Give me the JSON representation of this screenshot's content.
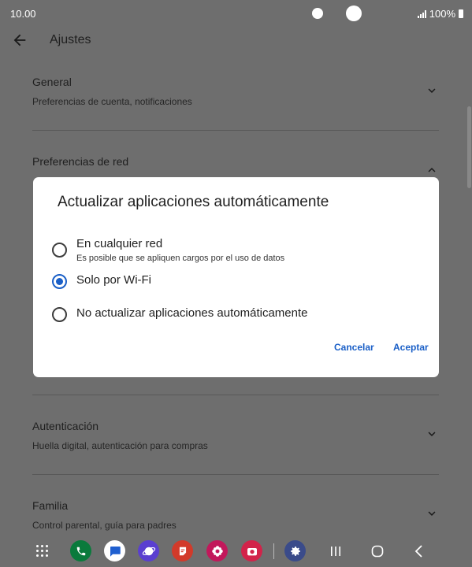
{
  "status_bar": {
    "time": "10.00",
    "battery": "100%"
  },
  "header": {
    "title": "Ajustes"
  },
  "sections": [
    {
      "title": "General",
      "subtitle": "Preferencias de cuenta, notificaciones"
    },
    {
      "title": "Preferencias de red",
      "subtitle": ""
    },
    {
      "title": "Autenticación",
      "subtitle": "Huella digital, autenticación para compras"
    },
    {
      "title": "Familia",
      "subtitle": "Control parental, guía para padres"
    }
  ],
  "dialog": {
    "title": "Actualizar aplicaciones automáticamente",
    "options": [
      {
        "label": "En cualquier red",
        "sublabel": "Es posible que se apliquen cargos por el uso de datos",
        "selected": false
      },
      {
        "label": "Solo por Wi-Fi",
        "sublabel": "",
        "selected": true
      },
      {
        "label": "No actualizar aplicaciones automáticamente",
        "sublabel": "",
        "selected": false
      }
    ],
    "cancel_label": "Cancelar",
    "accept_label": "Aceptar"
  },
  "dock": {
    "apps": [
      {
        "name": "phone-icon",
        "color": "#0a7a3c"
      },
      {
        "name": "messages-icon",
        "color": "#1f5fd0"
      },
      {
        "name": "internet-icon",
        "color": "#5a3fd0"
      },
      {
        "name": "notes-icon",
        "color": "#d23a2a"
      },
      {
        "name": "blossom-icon",
        "color": "#c2185b"
      },
      {
        "name": "camera-icon",
        "color": "#d2234a"
      },
      {
        "name": "settings-icon",
        "color": "#3a4b8a"
      }
    ]
  },
  "colors": {
    "accent": "#1a5fc7",
    "scrim": "#6e6e6e",
    "dialog_bg": "#ffffff"
  }
}
